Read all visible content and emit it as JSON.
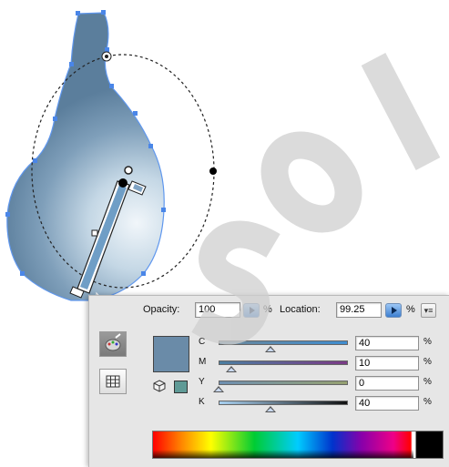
{
  "gradient_panel": {
    "opacity_label": "Opacity:",
    "opacity_value": "100",
    "opacity_unit": "%",
    "location_label": "Location:",
    "location_value": "99.25",
    "location_unit": "%",
    "menu_icon": "panel-menu-icon"
  },
  "color_stop": {
    "swatch_color": "#6a8ba8",
    "channels": [
      {
        "label": "C",
        "value": "40",
        "unit": "%",
        "level": 0.4
      },
      {
        "label": "M",
        "value": "10",
        "unit": "%",
        "level": 0.1
      },
      {
        "label": "Y",
        "value": "0",
        "unit": "%",
        "level": 0.0
      },
      {
        "label": "K",
        "value": "40",
        "unit": "%",
        "level": 0.4
      }
    ]
  },
  "mode_buttons": [
    {
      "icon": "color-mixer-icon"
    },
    {
      "icon": "swatches-grid-icon"
    }
  ],
  "tools": {
    "cursor": "arrow-pointer-icon",
    "out_of_gamut": "cube-3d-icon"
  },
  "colors": {
    "selection_blue": "#4a86e8",
    "vase_dark": "#5b7e9c",
    "vase_light": "#e8f1f7",
    "watermark": "#cfcfcf"
  }
}
